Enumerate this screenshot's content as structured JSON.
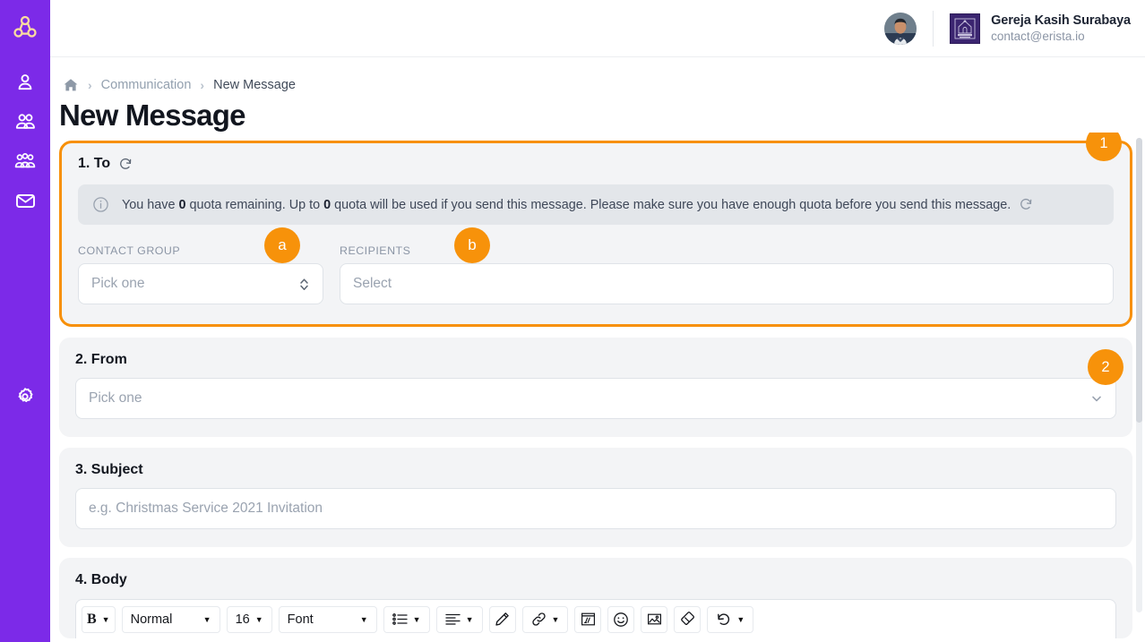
{
  "app": {
    "brand_color": "#7c2ae8",
    "accent_color": "#f7920a",
    "logo_icon": "erista-triad-logo-icon"
  },
  "sidebar": {
    "items": [
      {
        "icon": "person-icon",
        "name": "contacts"
      },
      {
        "icon": "two-people-icon",
        "name": "families"
      },
      {
        "icon": "group-people-icon",
        "name": "groups"
      },
      {
        "icon": "envelope-icon",
        "name": "communication"
      }
    ],
    "bottom": {
      "icon": "gear-icon",
      "name": "settings"
    }
  },
  "topbar": {
    "avatar_alt": "user-avatar",
    "org_logo_alt": "gereja-kasih-surabaya-logo",
    "org_name": "Gereja Kasih Surabaya",
    "org_email": "contact@erista.io"
  },
  "breadcrumb": {
    "home_icon": "home-icon",
    "separator": "›",
    "items": [
      {
        "label": "Communication",
        "active": false
      },
      {
        "label": "New Message",
        "active": true
      }
    ]
  },
  "page": {
    "title": "New Message"
  },
  "sections": {
    "to": {
      "title": "1. To",
      "refresh_icon": "refresh-icon",
      "badge": "1",
      "banner": {
        "info_icon": "info-circle-icon",
        "text_1": "You have ",
        "bold_1": "0",
        "text_2": " quota remaining. Up to ",
        "bold_2": "0",
        "text_3": " quota will be used if you send this message. Please make sure you have enough quota before you send this message.",
        "refresh_icon": "refresh-icon"
      },
      "contact_group": {
        "label": "CONTACT GROUP",
        "placeholder": "Pick one",
        "badge": "a",
        "chevron_icon": "chevron-updown-icon"
      },
      "recipients": {
        "label": "RECIPIENTS",
        "placeholder": "Select",
        "badge": "b"
      }
    },
    "from": {
      "title": "2. From",
      "placeholder": "Pick one",
      "badge": "2",
      "chevron_icon": "chevron-down-icon"
    },
    "subject": {
      "title": "3. Subject",
      "placeholder": "e.g. Christmas Service 2021 Invitation"
    },
    "body": {
      "title": "4. Body",
      "toolbar": [
        {
          "name": "bold-button",
          "label": "B",
          "icon": "bold-icon",
          "caret": true,
          "type": "icon"
        },
        {
          "name": "heading-select",
          "label": "Normal",
          "caret": true,
          "type": "text"
        },
        {
          "name": "font-size-select",
          "label": "16",
          "caret": true,
          "type": "text"
        },
        {
          "name": "font-family-select",
          "label": "Font",
          "caret": true,
          "type": "text"
        },
        {
          "name": "list-button",
          "icon": "bulleted-list-icon",
          "caret": true,
          "type": "icon"
        },
        {
          "name": "align-button",
          "icon": "align-left-icon",
          "caret": true,
          "type": "icon"
        },
        {
          "name": "pen-button",
          "icon": "pen-icon",
          "caret": false,
          "type": "icon"
        },
        {
          "name": "link-button",
          "icon": "link-icon",
          "caret": true,
          "type": "icon"
        },
        {
          "name": "media-button",
          "icon": "media-embed-icon",
          "caret": false,
          "type": "icon"
        },
        {
          "name": "emoji-button",
          "icon": "smiley-icon",
          "caret": false,
          "type": "icon"
        },
        {
          "name": "image-button",
          "icon": "image-icon",
          "caret": false,
          "type": "icon"
        },
        {
          "name": "eraser-button",
          "icon": "eraser-icon",
          "caret": false,
          "type": "icon"
        },
        {
          "name": "undo-button",
          "icon": "undo-icon",
          "caret": true,
          "type": "icon"
        }
      ]
    }
  }
}
